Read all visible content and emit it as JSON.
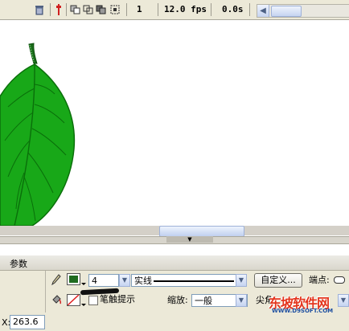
{
  "toolbar": {
    "frame": "1",
    "fps": "12.0 fps",
    "time": "0.0s"
  },
  "panel": {
    "title": "参数",
    "stroke_width": "4",
    "stroke_style": "实线",
    "custom_button": "自定义...",
    "cap_label": "端点:",
    "hinting_label": "笔触提示",
    "scale_label": "缩放:",
    "scale_value": "一般",
    "join_label": "尖角",
    "x_label": "X:",
    "x_value": "263.6"
  },
  "colors": {
    "stroke_color": "#1f6b1f",
    "leaf_fill": "#16a616",
    "leaf_veins": "#0a6f0a"
  },
  "watermark": {
    "brand": "东坡软件网",
    "url": "WWW.D9SOFT.COM"
  }
}
